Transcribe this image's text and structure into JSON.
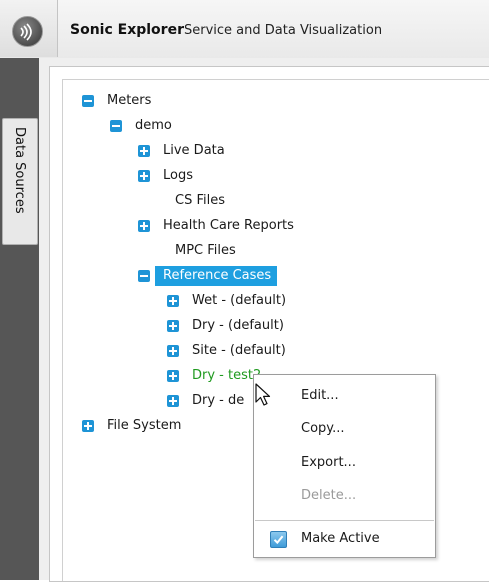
{
  "app": {
    "title": "Sonic Explorer",
    "subtitle": "Service and Data Visualization",
    "logo_icon": "wave-logo-icon"
  },
  "sidebar": {
    "tab_label": "Data Sources"
  },
  "tree": {
    "root": {
      "label": "Meters",
      "toggle": "collapse"
    },
    "demo": {
      "label": "demo",
      "toggle": "collapse"
    },
    "live_data": {
      "label": "Live Data",
      "toggle": "expand"
    },
    "logs": {
      "label": "Logs",
      "toggle": "expand"
    },
    "cs_files": {
      "label": "CS Files"
    },
    "health_care": {
      "label": "Health Care Reports",
      "toggle": "expand"
    },
    "mpc_files": {
      "label": "MPC Files"
    },
    "reference_cases": {
      "label": "Reference Cases",
      "toggle": "collapse",
      "selected": true
    },
    "wet_default": {
      "label": "Wet - (default)",
      "toggle": "expand"
    },
    "dry_default": {
      "label": "Dry - (default)",
      "toggle": "expand"
    },
    "site_default": {
      "label": "Site - (default)",
      "toggle": "expand"
    },
    "dry_test": {
      "label": "Dry - test2",
      "toggle": "expand",
      "color": "#1f9a1f"
    },
    "dry_de": {
      "label": "Dry - de",
      "toggle": "expand"
    },
    "file_system": {
      "label": "File System",
      "toggle": "expand"
    }
  },
  "context_menu": {
    "edit": "Edit...",
    "copy": "Copy...",
    "export": "Export...",
    "delete": "Delete...",
    "make_active": "Make Active",
    "make_active_checked": true
  },
  "colors": {
    "accent": "#1e9fe0",
    "toggle": "#1e94d6",
    "active_item": "#1f9a1f"
  }
}
